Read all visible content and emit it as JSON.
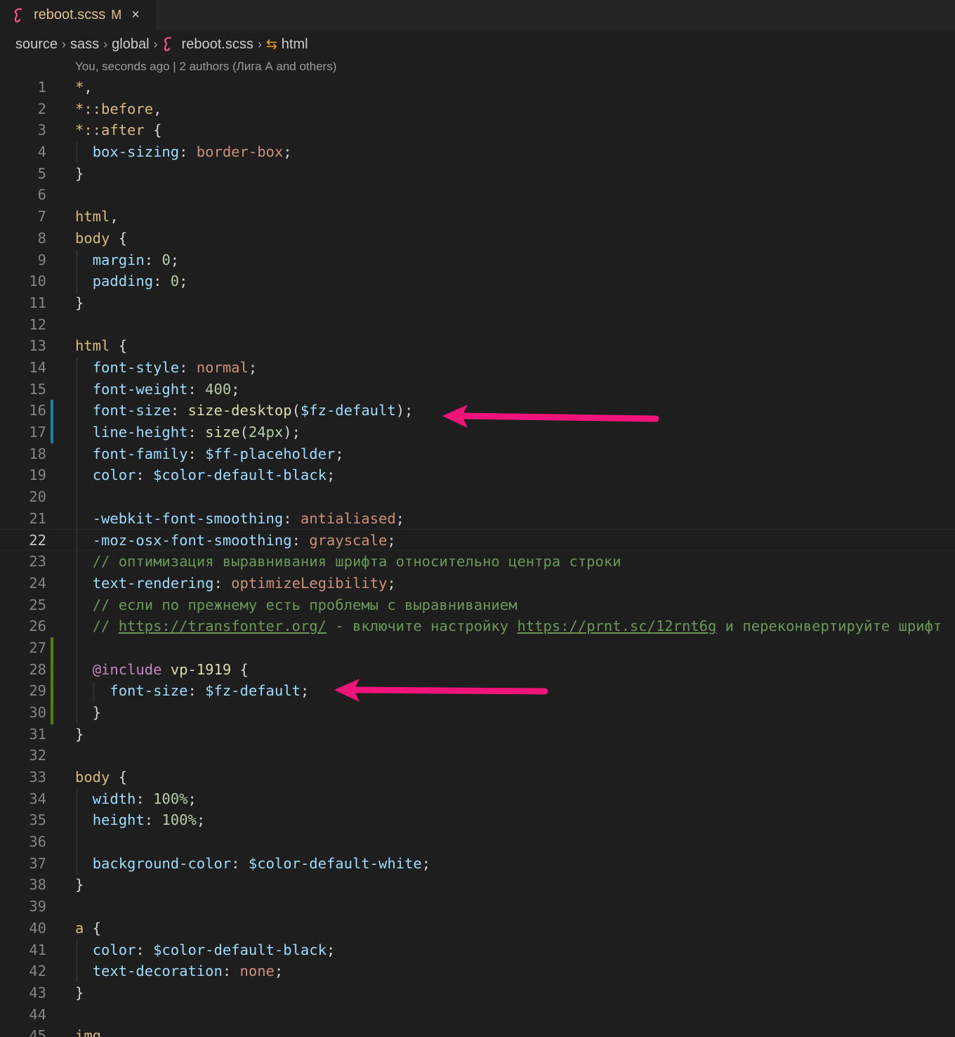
{
  "tab": {
    "file_name": "reboot.scss",
    "modified_flag": "M",
    "close_glyph": "×",
    "icon": "sass-icon"
  },
  "breadcrumb": {
    "items": [
      "source",
      "sass",
      "global",
      "reboot.scss",
      "html"
    ],
    "separator": "›"
  },
  "blame": "You, seconds ago | 2 authors (Лига А and others)",
  "colors": {
    "background": "#1e1e1e",
    "arrow": "#f0147a",
    "modified_gutter": "#1b81a8",
    "added_gutter": "#587c0c"
  },
  "lines": [
    {
      "n": "1",
      "tokens": [
        [
          "star",
          "*"
        ],
        [
          "pun",
          ","
        ]
      ]
    },
    {
      "n": "2",
      "tokens": [
        [
          "star",
          "*"
        ],
        [
          "sel",
          "::before"
        ],
        [
          "pun",
          ","
        ]
      ]
    },
    {
      "n": "3",
      "tokens": [
        [
          "star",
          "*"
        ],
        [
          "sel",
          "::after"
        ],
        [
          "pun",
          " {"
        ]
      ]
    },
    {
      "n": "4",
      "tokens": [
        [
          "pun",
          "  "
        ],
        [
          "prop",
          "box-sizing"
        ],
        [
          "pun",
          ": "
        ],
        [
          "val",
          "border-box"
        ],
        [
          "pun",
          ";"
        ]
      ]
    },
    {
      "n": "5",
      "tokens": [
        [
          "pun",
          "}"
        ]
      ]
    },
    {
      "n": "6",
      "tokens": []
    },
    {
      "n": "7",
      "tokens": [
        [
          "tag",
          "html"
        ],
        [
          "pun",
          ","
        ]
      ]
    },
    {
      "n": "8",
      "tokens": [
        [
          "tag",
          "body"
        ],
        [
          "pun",
          " {"
        ]
      ]
    },
    {
      "n": "9",
      "tokens": [
        [
          "pun",
          "  "
        ],
        [
          "prop",
          "margin"
        ],
        [
          "pun",
          ": "
        ],
        [
          "num",
          "0"
        ],
        [
          "pun",
          ";"
        ]
      ]
    },
    {
      "n": "10",
      "tokens": [
        [
          "pun",
          "  "
        ],
        [
          "prop",
          "padding"
        ],
        [
          "pun",
          ": "
        ],
        [
          "num",
          "0"
        ],
        [
          "pun",
          ";"
        ]
      ]
    },
    {
      "n": "11",
      "tokens": [
        [
          "pun",
          "}"
        ]
      ]
    },
    {
      "n": "12",
      "tokens": []
    },
    {
      "n": "13",
      "tokens": [
        [
          "tag",
          "html"
        ],
        [
          "pun",
          " {"
        ]
      ]
    },
    {
      "n": "14",
      "tokens": [
        [
          "pun",
          "  "
        ],
        [
          "prop",
          "font-style"
        ],
        [
          "pun",
          ": "
        ],
        [
          "val",
          "normal"
        ],
        [
          "pun",
          ";"
        ]
      ]
    },
    {
      "n": "15",
      "tokens": [
        [
          "pun",
          "  "
        ],
        [
          "prop",
          "font-weight"
        ],
        [
          "pun",
          ": "
        ],
        [
          "num",
          "400"
        ],
        [
          "pun",
          ";"
        ]
      ]
    },
    {
      "n": "16",
      "tokens": [
        [
          "pun",
          "  "
        ],
        [
          "prop",
          "font-size"
        ],
        [
          "pun",
          ": "
        ],
        [
          "fn",
          "size-desktop"
        ],
        [
          "pun",
          "("
        ],
        [
          "var",
          "$fz-default"
        ],
        [
          "pun",
          ");"
        ]
      ]
    },
    {
      "n": "17",
      "tokens": [
        [
          "pun",
          "  "
        ],
        [
          "prop",
          "line-height"
        ],
        [
          "pun",
          ": "
        ],
        [
          "fn",
          "size"
        ],
        [
          "pun",
          "("
        ],
        [
          "num",
          "24px"
        ],
        [
          "pun",
          ");"
        ]
      ]
    },
    {
      "n": "18",
      "tokens": [
        [
          "pun",
          "  "
        ],
        [
          "prop",
          "font-family"
        ],
        [
          "pun",
          ": "
        ],
        [
          "var",
          "$ff-placeholder"
        ],
        [
          "pun",
          ";"
        ]
      ]
    },
    {
      "n": "19",
      "tokens": [
        [
          "pun",
          "  "
        ],
        [
          "prop",
          "color"
        ],
        [
          "pun",
          ": "
        ],
        [
          "var",
          "$color-default-black"
        ],
        [
          "pun",
          ";"
        ]
      ]
    },
    {
      "n": "20",
      "tokens": []
    },
    {
      "n": "21",
      "tokens": [
        [
          "pun",
          "  "
        ],
        [
          "prop",
          "-webkit-font-smoothing"
        ],
        [
          "pun",
          ": "
        ],
        [
          "val",
          "antialiased"
        ],
        [
          "pun",
          ";"
        ]
      ]
    },
    {
      "n": "22",
      "tokens": [
        [
          "pun",
          "  "
        ],
        [
          "prop",
          "-moz-osx-font-smoothing"
        ],
        [
          "pun",
          ": "
        ],
        [
          "val",
          "grayscale"
        ],
        [
          "pun",
          ";"
        ]
      ]
    },
    {
      "n": "23",
      "tokens": [
        [
          "pun",
          "  "
        ],
        [
          "cmt",
          "// оптимизация выравнивания шрифта относительно центра строки"
        ]
      ]
    },
    {
      "n": "24",
      "tokens": [
        [
          "pun",
          "  "
        ],
        [
          "prop",
          "text-rendering"
        ],
        [
          "pun",
          ": "
        ],
        [
          "val",
          "optimizeLegibility"
        ],
        [
          "pun",
          ";"
        ]
      ]
    },
    {
      "n": "25",
      "tokens": [
        [
          "pun",
          "  "
        ],
        [
          "cmt",
          "// если по прежнему есть проблемы с выравниванием"
        ]
      ]
    },
    {
      "n": "26",
      "tokens": [
        [
          "pun",
          "  "
        ],
        [
          "cmt",
          "// "
        ],
        [
          "link",
          "https://transfonter.org/"
        ],
        [
          "cmt",
          " - включите настройку "
        ],
        [
          "link",
          "https://prnt.sc/12rnt6g"
        ],
        [
          "cmt",
          " и переконвертируйте шрифт"
        ]
      ]
    },
    {
      "n": "27",
      "tokens": []
    },
    {
      "n": "28",
      "tokens": [
        [
          "pun",
          "  "
        ],
        [
          "at",
          "@include"
        ],
        [
          "pun",
          " "
        ],
        [
          "fn",
          "vp-1919"
        ],
        [
          "pun",
          " {"
        ]
      ]
    },
    {
      "n": "29",
      "tokens": [
        [
          "pun",
          "    "
        ],
        [
          "prop",
          "font-size"
        ],
        [
          "pun",
          ": "
        ],
        [
          "var",
          "$fz-default"
        ],
        [
          "pun",
          ";"
        ]
      ]
    },
    {
      "n": "30",
      "tokens": [
        [
          "pun",
          "  }"
        ]
      ]
    },
    {
      "n": "31",
      "tokens": [
        [
          "pun",
          "}"
        ]
      ]
    },
    {
      "n": "32",
      "tokens": []
    },
    {
      "n": "33",
      "tokens": [
        [
          "tag",
          "body"
        ],
        [
          "pun",
          " {"
        ]
      ]
    },
    {
      "n": "34",
      "tokens": [
        [
          "pun",
          "  "
        ],
        [
          "prop",
          "width"
        ],
        [
          "pun",
          ": "
        ],
        [
          "num",
          "100%"
        ],
        [
          "pun",
          ";"
        ]
      ]
    },
    {
      "n": "35",
      "tokens": [
        [
          "pun",
          "  "
        ],
        [
          "prop",
          "height"
        ],
        [
          "pun",
          ": "
        ],
        [
          "num",
          "100%"
        ],
        [
          "pun",
          ";"
        ]
      ]
    },
    {
      "n": "36",
      "tokens": []
    },
    {
      "n": "37",
      "tokens": [
        [
          "pun",
          "  "
        ],
        [
          "prop",
          "background-color"
        ],
        [
          "pun",
          ": "
        ],
        [
          "var",
          "$color-default-white"
        ],
        [
          "pun",
          ";"
        ]
      ]
    },
    {
      "n": "38",
      "tokens": [
        [
          "pun",
          "}"
        ]
      ]
    },
    {
      "n": "39",
      "tokens": []
    },
    {
      "n": "40",
      "tokens": [
        [
          "tag",
          "a"
        ],
        [
          "pun",
          " {"
        ]
      ]
    },
    {
      "n": "41",
      "tokens": [
        [
          "pun",
          "  "
        ],
        [
          "prop",
          "color"
        ],
        [
          "pun",
          ": "
        ],
        [
          "var",
          "$color-default-black"
        ],
        [
          "pun",
          ";"
        ]
      ]
    },
    {
      "n": "42",
      "tokens": [
        [
          "pun",
          "  "
        ],
        [
          "prop",
          "text-decoration"
        ],
        [
          "pun",
          ": "
        ],
        [
          "val",
          "none"
        ],
        [
          "pun",
          ";"
        ]
      ]
    },
    {
      "n": "43",
      "tokens": [
        [
          "pun",
          "}"
        ]
      ]
    },
    {
      "n": "44",
      "tokens": []
    },
    {
      "n": "45",
      "tokens": [
        [
          "tag",
          "img"
        ]
      ]
    }
  ],
  "active_line": "22"
}
